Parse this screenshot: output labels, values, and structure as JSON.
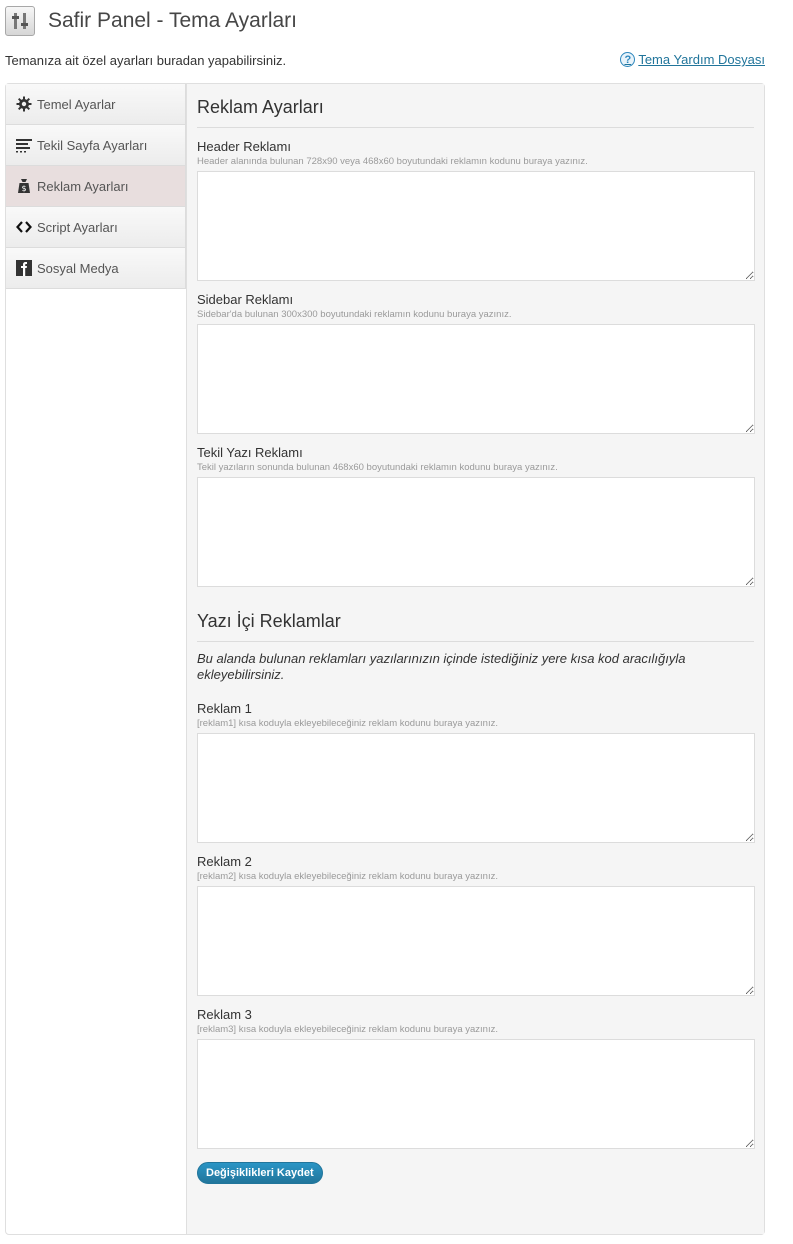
{
  "header": {
    "title": "Safir Panel - Tema Ayarları",
    "intro": "Temanıza ait özel ayarları buradan yapabilirsiniz.",
    "help_link": "Tema Yardım Dosyası"
  },
  "sidebar": {
    "items": [
      {
        "label": "Temel Ayarlar",
        "icon": "gear-icon"
      },
      {
        "label": "Tekil Sayfa Ayarları",
        "icon": "lines-icon"
      },
      {
        "label": "Reklam Ayarları",
        "icon": "money-bag-icon",
        "active": true
      },
      {
        "label": "Script Ayarları",
        "icon": "code-icon"
      },
      {
        "label": "Sosyal Medya",
        "icon": "facebook-icon"
      }
    ]
  },
  "main": {
    "section1_title": "Reklam Ayarları",
    "fields1": [
      {
        "label": "Header Reklamı",
        "desc": "Header alanında bulunan 728x90 veya 468x60 boyutundaki reklamın kodunu buraya yazınız.",
        "value": ""
      },
      {
        "label": "Sidebar Reklamı",
        "desc": "Sidebar'da bulunan 300x300 boyutundaki reklamın kodunu buraya yazınız.",
        "value": ""
      },
      {
        "label": "Tekil Yazı Reklamı",
        "desc": "Tekil yazıların sonunda bulunan 468x60 boyutundaki reklamın kodunu buraya yazınız.",
        "value": ""
      }
    ],
    "section2_title": "Yazı İçi Reklamlar",
    "section2_note": "Bu alanda bulunan reklamları yazılarınızın içinde istediğiniz yere kısa kod aracılığıyla ekleyebilirsiniz.",
    "fields2": [
      {
        "label": "Reklam 1",
        "desc": "[reklam1] kısa koduyla ekleyebileceğiniz reklam kodunu buraya yazınız.",
        "value": ""
      },
      {
        "label": "Reklam 2",
        "desc": "[reklam2] kısa koduyla ekleyebileceğiniz reklam kodunu buraya yazınız.",
        "value": ""
      },
      {
        "label": "Reklam 3",
        "desc": "[reklam3] kısa koduyla ekleyebileceğiniz reklam kodunu buraya yazınız.",
        "value": ""
      }
    ],
    "save_label": "Değişiklikleri Kaydet"
  },
  "colors": {
    "accent": "#21759b",
    "active_tab": "#e8dede",
    "panel_bg": "#f5f5f5"
  }
}
